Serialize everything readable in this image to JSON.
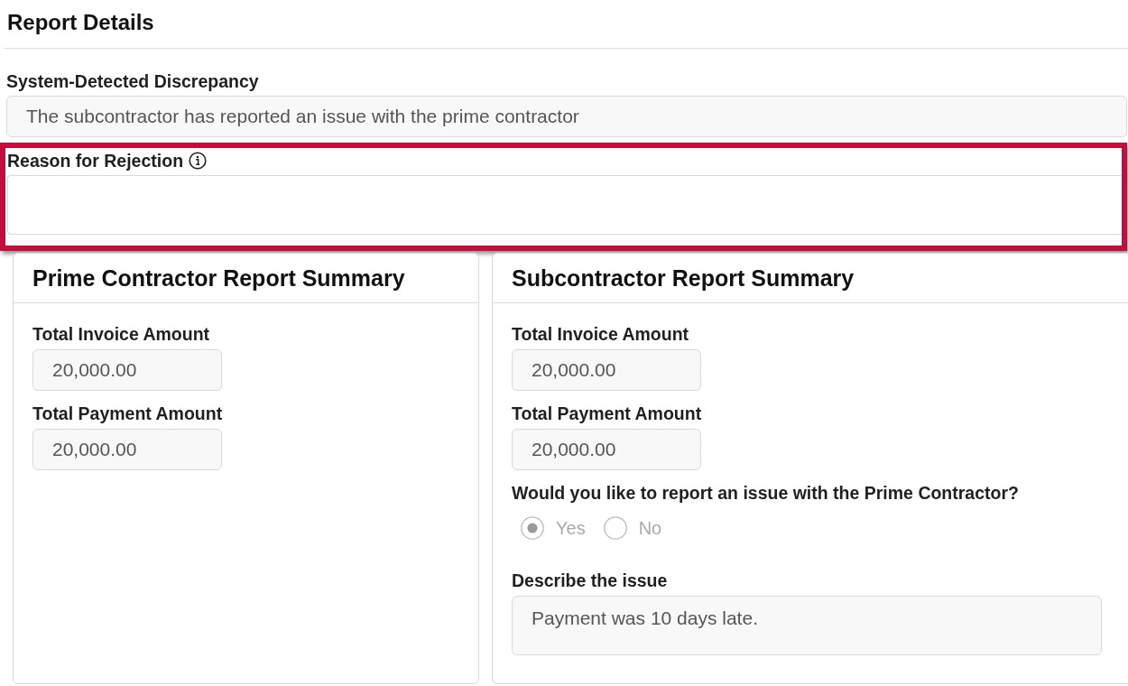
{
  "page": {
    "title": "Report Details"
  },
  "discrepancy": {
    "label": "System-Detected Discrepancy",
    "value": "The subcontractor has reported an issue with the prime contractor"
  },
  "rejection_reason": {
    "label": "Reason for Rejection",
    "highlighted": true
  },
  "summaries": [
    {
      "title": "Prime Contractor Report Summary",
      "fields": [
        {
          "label": "Total Invoice Amount",
          "value": "20,000.00"
        },
        {
          "label": "Total Payment Amount",
          "value": "20,000.00"
        }
      ]
    },
    {
      "title": "Subcontractor Report Summary",
      "fields": [
        {
          "label": "Total Invoice Amount",
          "value": "20,000.00"
        },
        {
          "label": "Total Payment Amount",
          "value": "20,000.00"
        }
      ],
      "question": {
        "label": "Would you like to report an issue with the Prime Contractor?",
        "disabled": true,
        "options": [
          {
            "label": "Yes",
            "selected": true
          },
          {
            "label": "No",
            "selected": false
          }
        ]
      },
      "description": {
        "label": "Describe the issue",
        "value": "Payment was 10 days late."
      }
    }
  ]
}
